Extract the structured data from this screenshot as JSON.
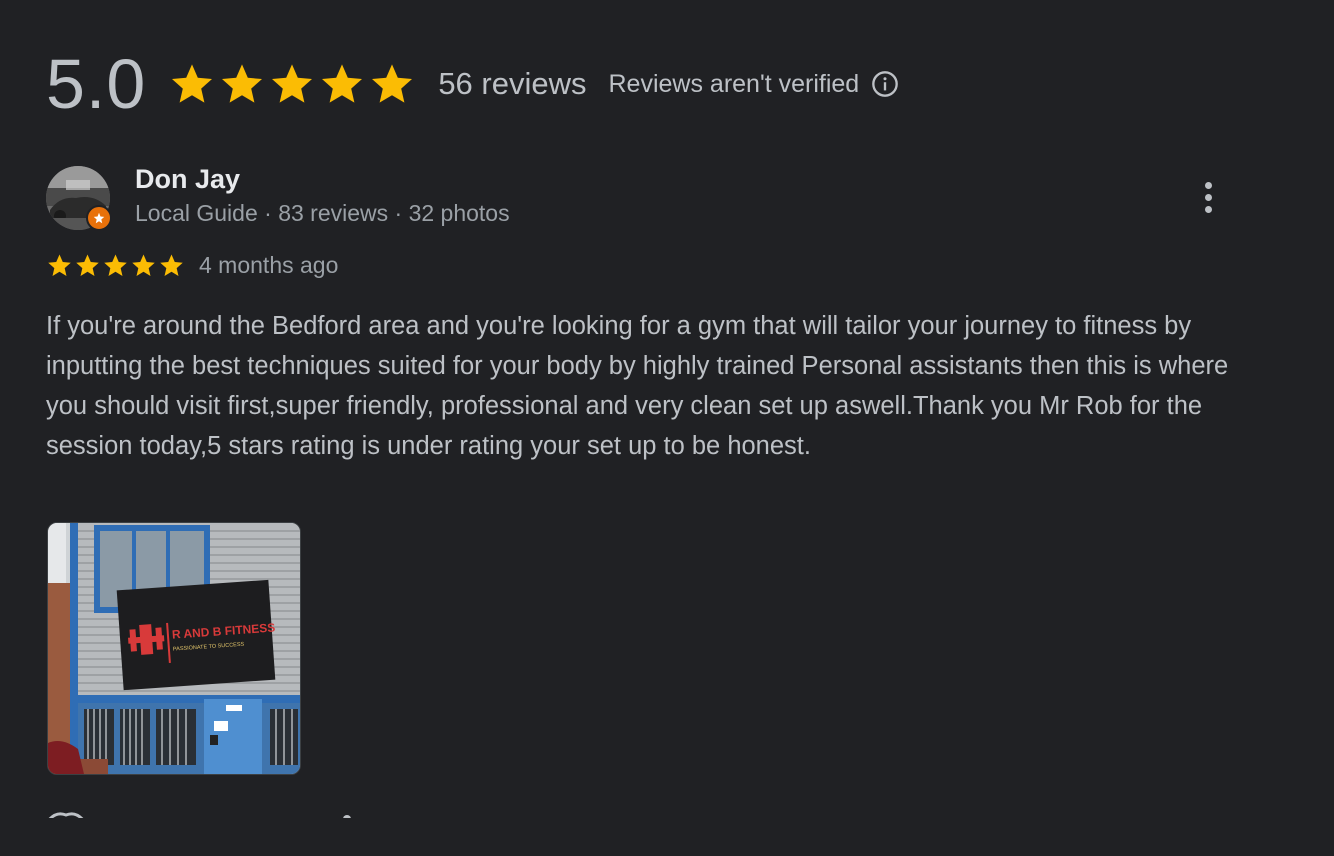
{
  "summary": {
    "rating": "5.0",
    "stars_filled": 5,
    "review_count": "56 reviews",
    "unverified_text": "Reviews aren't verified",
    "info_icon": "info-icon"
  },
  "review": {
    "reviewer_name": "Don Jay",
    "reviewer_meta": "Local Guide · 83 reviews · 32 photos",
    "rating": 5,
    "time": "4 months ago",
    "text": "If you're around the Bedford area and you're looking for a gym that will tailor your journey to fitness by inputting the best techniques suited for your body by highly trained Personal assistants then this is where you should visit first,super friendly, professional and very clean set up aswell.Thank you Mr Rob for the session today,5 stars rating is under rating your set up to be honest.",
    "photo": {
      "sign_title": "R AND B FITNESS",
      "sign_tagline": "PASSIONATE TO SUCCESS"
    },
    "more_icon": "more-vert-icon"
  },
  "colors": {
    "background": "#202124",
    "star": "#fbbc04",
    "text_primary": "#e8eaed",
    "text_secondary": "#bdc1c6",
    "text_muted": "#9aa0a6",
    "local_guide_badge": "#e8710a"
  }
}
